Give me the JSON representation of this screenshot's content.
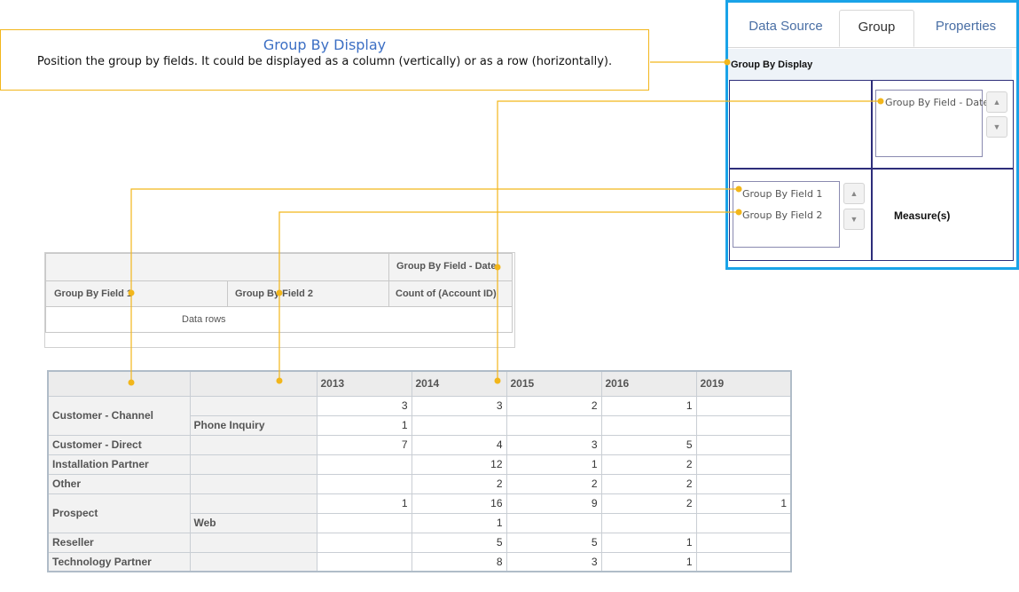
{
  "callout": {
    "title": "Group By Display",
    "text": "Position the group by fields. It could be displayed as a column (vertically) or as a row (horizontally)."
  },
  "panel": {
    "tabs": [
      {
        "label": "Data Source",
        "active": false
      },
      {
        "label": "Group",
        "active": true
      },
      {
        "label": "Properties",
        "active": false
      }
    ],
    "section_title": "Group By Display",
    "column_fields": [
      "Group By Field - Date"
    ],
    "row_fields": [
      "Group By Field 1",
      "Group By Field 2"
    ],
    "measures_label": "Measure(s)"
  },
  "preview": {
    "column_field": "Group By Field - Date",
    "row_field_1": "Group By Field 1",
    "row_field_2": "Group By Field 2",
    "measure": "Count of (Account ID)",
    "data_rows": "Data rows"
  },
  "grid": {
    "years": [
      "2013",
      "2014",
      "2015",
      "2016",
      "2019"
    ],
    "rows": [
      {
        "group": "Customer - Channel",
        "sub": "",
        "values": [
          "3",
          "3",
          "2",
          "1",
          ""
        ]
      },
      {
        "group": "",
        "sub": "Phone Inquiry",
        "values": [
          "1",
          "",
          "",
          "",
          ""
        ]
      },
      {
        "group": "Customer - Direct",
        "sub": "",
        "values": [
          "7",
          "4",
          "3",
          "5",
          ""
        ]
      },
      {
        "group": "Installation Partner",
        "sub": "",
        "values": [
          "",
          "12",
          "1",
          "2",
          ""
        ]
      },
      {
        "group": "Other",
        "sub": "",
        "values": [
          "",
          "2",
          "2",
          "2",
          ""
        ]
      },
      {
        "group": "Prospect",
        "sub": "",
        "values": [
          "1",
          "16",
          "9",
          "2",
          "1"
        ]
      },
      {
        "group": "",
        "sub": "Web",
        "values": [
          "",
          "1",
          "",
          "",
          ""
        ]
      },
      {
        "group": "Reseller",
        "sub": "",
        "values": [
          "",
          "5",
          "5",
          "1",
          ""
        ]
      },
      {
        "group": "Technology Partner",
        "sub": "",
        "values": [
          "",
          "8",
          "3",
          "1",
          ""
        ]
      }
    ]
  },
  "colors": {
    "connector": "#f2b61b",
    "panel_border": "#1aa3e8",
    "callout_title": "#3c6fc4"
  }
}
